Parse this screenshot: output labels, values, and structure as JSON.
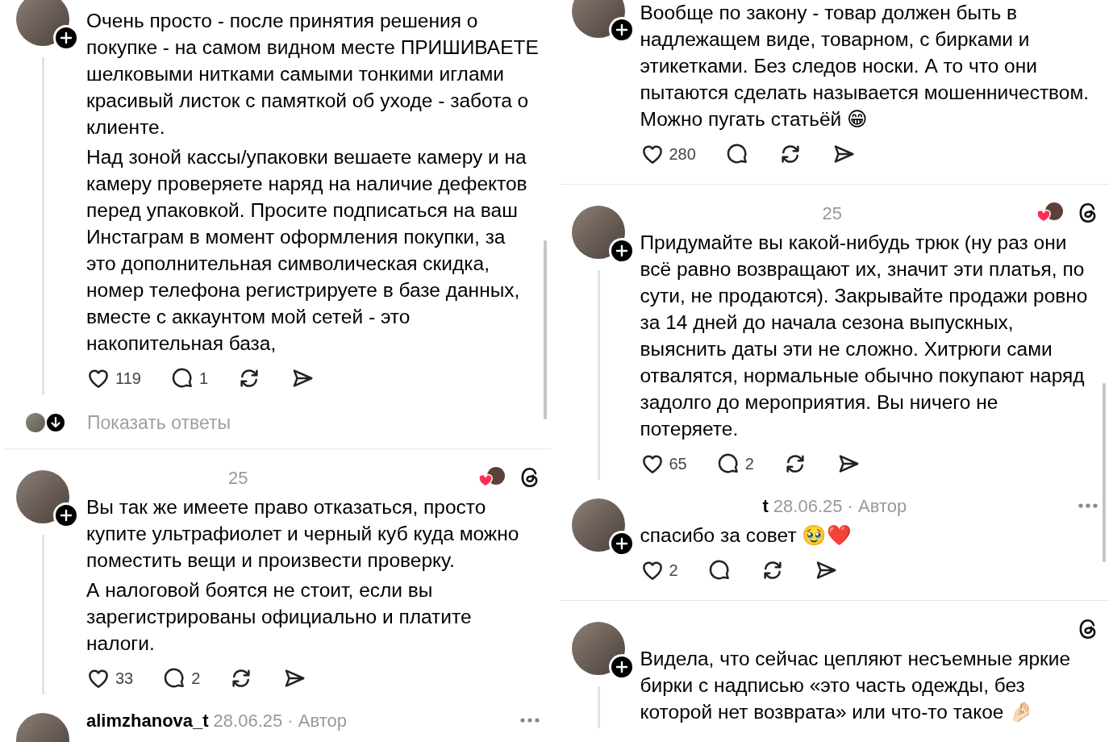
{
  "columns": [
    {
      "items": [
        {
          "kind": "post",
          "thread_line": true,
          "paragraphs": [
            "Очень просто - после принятия решения о покупке - на самом видном месте ПРИШИВАЕТЕ шелковыми нитками самыми тонкими иглами красивый листок с памяткой об уходе - забота о клиенте.",
            "Над зоной кассы/упаковки вешаете камеру и на камеру проверяете наряд на наличие дефектов перед упаковкой. Просите подписаться на ваш Инстаграм в момент оформления покупки, за это дополнительная символическая скидка, номер телефона регистрируете в базе данных, вместе с аккаунтом мой сетей - это накопительная база,"
          ],
          "likes": "119",
          "replies": "1"
        },
        {
          "kind": "show_replies",
          "label": "Показать ответы"
        },
        {
          "kind": "separator"
        },
        {
          "kind": "post",
          "thread_line": true,
          "meta": "25",
          "liked_by_author": true,
          "threads_mark": true,
          "paragraphs": [
            "Вы так же имеете право отказаться, просто купите ультрафиолет и черный куб куда можно поместить вещи и произвести проверку.",
            "А налоговой боятся не стоит, если вы зарегистрированы официально и платите налоги."
          ],
          "likes": "33",
          "replies": "2"
        },
        {
          "kind": "post",
          "thread_line": false,
          "username": "alimzhanova_t",
          "meta": "28.06.25 · Автор",
          "more_menu": true
        }
      ]
    },
    {
      "items": [
        {
          "kind": "post",
          "thread_line": false,
          "paragraphs": [
            "Вообще по закону - товар должен быть в надлежащем виде, товарном, с бирками и этикетками. Без следов носки. А то что они пытаются сделать называется мошенничеством. Можно пугать статьёй 😁"
          ],
          "likes": "280"
        },
        {
          "kind": "separator"
        },
        {
          "kind": "post",
          "thread_line": true,
          "meta": "25",
          "liked_by_author": true,
          "threads_mark": true,
          "paragraphs": [
            "Придумайте вы какой-нибудь трюк (ну раз они всё равно возвращают их, значит эти платья, по сути, не продаются). Закрывайте продажи ровно за 14 дней до начала сезона выпускных, выяснить даты эти не сложно. Хитрюги сами отвалятся, нормальные обычно покупают наряд задолго до мероприятия. Вы ничего не потеряете."
          ],
          "likes": "65",
          "replies": "2"
        },
        {
          "kind": "post",
          "thread_line": false,
          "username": "t",
          "meta": "28.06.25 · Автор",
          "more_menu": true,
          "paragraphs": [
            "спасибо за совет 🥹❤️"
          ],
          "likes": "2"
        },
        {
          "kind": "separator"
        },
        {
          "kind": "post",
          "thread_line": true,
          "threads_mark": true,
          "paragraphs": [
            "Видела, что сейчас цепляют несъемные яркие бирки с надписью «это часть одежды, без которой нет возврата» или что-то такое 🤌🏻"
          ]
        }
      ]
    }
  ]
}
